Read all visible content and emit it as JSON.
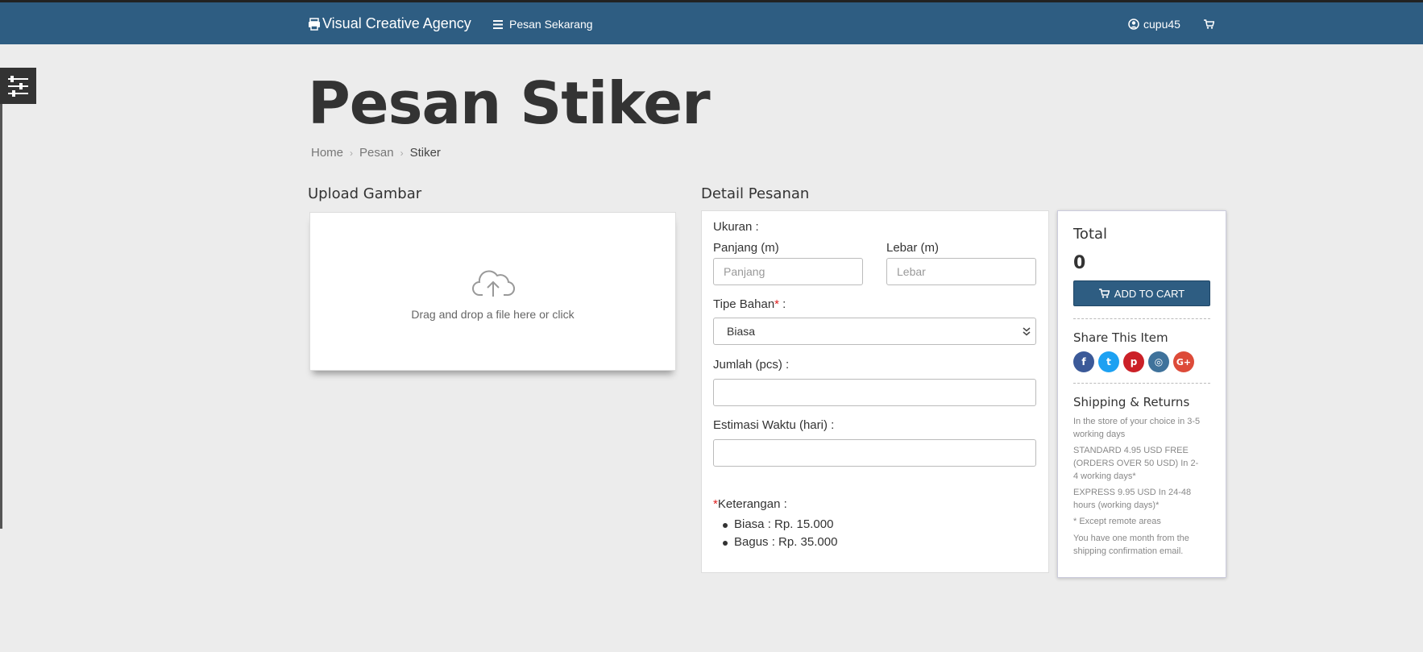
{
  "header": {
    "brand": "Visual Creative Agency",
    "order_link": "Pesan Sekarang",
    "username": "cupu45",
    "bg_color": "#2e5d82"
  },
  "page": {
    "title": "Pesan Stiker",
    "breadcrumb": [
      "Home",
      "Pesan",
      "Stiker"
    ]
  },
  "upload": {
    "heading": "Upload Gambar",
    "dropzone_text": "Drag and drop a file here or click"
  },
  "detail": {
    "heading": "Detail Pesanan",
    "size_label": "Ukuran :",
    "length_label": "Panjang (m)",
    "length_placeholder": "Panjang",
    "width_label": "Lebar (m)",
    "width_placeholder": "Lebar",
    "material_label": "Tipe Bahan",
    "material_suffix": " :",
    "material_selected": "Biasa",
    "qty_label": "Jumlah (pcs) :",
    "qty_value": "",
    "eta_label": "Estimasi Waktu (hari) :",
    "eta_value": "",
    "notes_label": "Keterangan :",
    "notes": [
      "Biasa : Rp. 15.000",
      "Bagus : Rp. 35.000"
    ]
  },
  "summary": {
    "total_label": "Total",
    "total_value": "0",
    "add_to_cart": "ADD TO CART",
    "share_title": "Share This Item",
    "socials": [
      {
        "name": "facebook",
        "glyph": "f",
        "color": "#3b5998"
      },
      {
        "name": "twitter",
        "glyph": "t",
        "color": "#1da1f2"
      },
      {
        "name": "pinterest",
        "glyph": "p",
        "color": "#cb2027"
      },
      {
        "name": "instagram",
        "glyph": "◎",
        "color": "#3f729b"
      },
      {
        "name": "google-plus",
        "glyph": "G+",
        "color": "#dd4b39"
      }
    ],
    "shipping_title": "Shipping & Returns",
    "shipping_lines": [
      "In the store of your choice in 3-5 working days",
      "STANDARD 4.95 USD FREE (ORDERS OVER 50 USD) In 2-4 working days*",
      "EXPRESS 9.95 USD In 24-48 hours (working days)*",
      "* Except remote areas",
      "You have one month from the shipping confirmation email."
    ]
  }
}
